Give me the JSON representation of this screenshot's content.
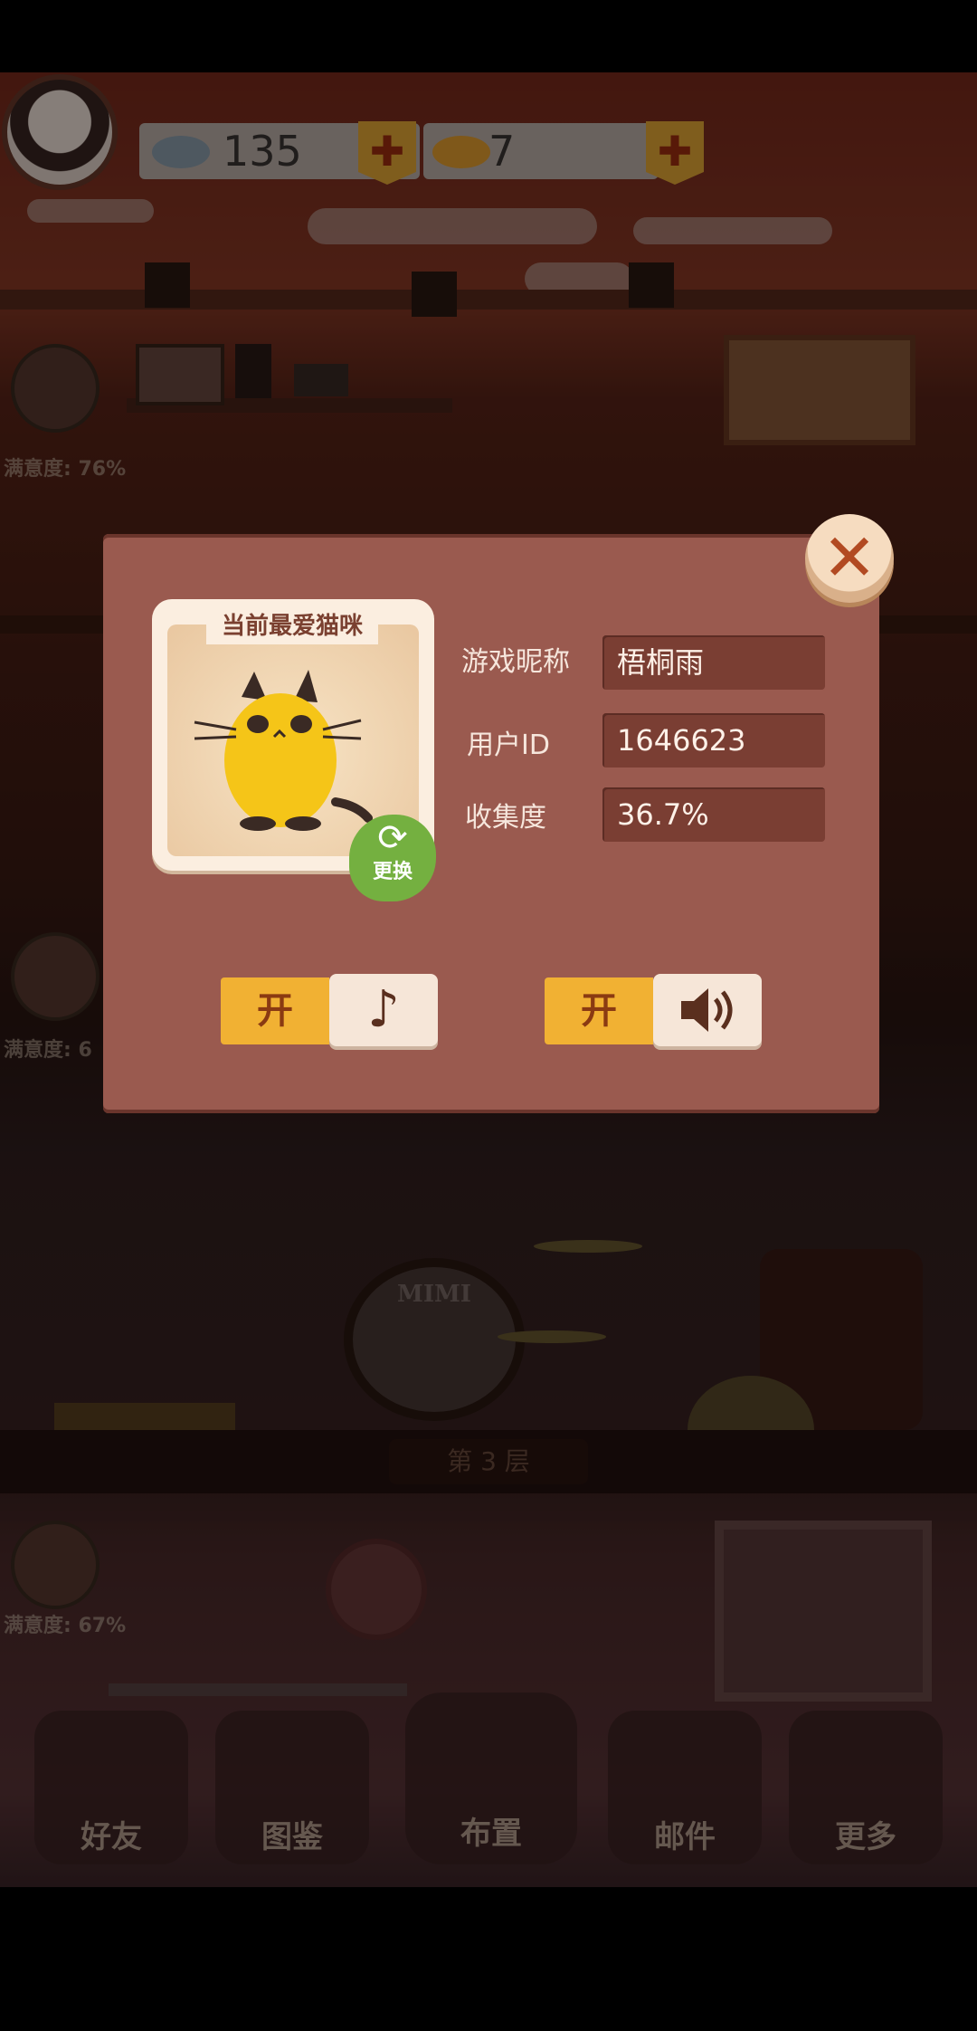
{
  "hud": {
    "fish_count": "135",
    "gold_fish_count": "7",
    "plus_label": "✚"
  },
  "scene": {
    "satisfaction": [
      "满意度: 76%",
      "满意度: 6",
      "满意度: 67%"
    ],
    "floor_label": "第 3 层",
    "drum_text": "MIMI",
    "bottom_nav": [
      "好友",
      "图鉴",
      "布置",
      "邮件",
      "更多"
    ]
  },
  "dialog": {
    "card_title": "当前最爱猫咪",
    "change_label": "更换",
    "fields": [
      {
        "label": "游戏昵称",
        "value": "梧桐雨"
      },
      {
        "label": "用户ID",
        "value": "1646623"
      },
      {
        "label": "收集度",
        "value": "36.7%"
      }
    ],
    "music_toggle_label": "开",
    "sound_toggle_label": "开",
    "close_label": "✕"
  },
  "colors": {
    "dialog_bg": "#9a5a4f",
    "field_bg": "#7a3e33",
    "toggle_on": "#f1b133",
    "change_green": "#74b040"
  }
}
